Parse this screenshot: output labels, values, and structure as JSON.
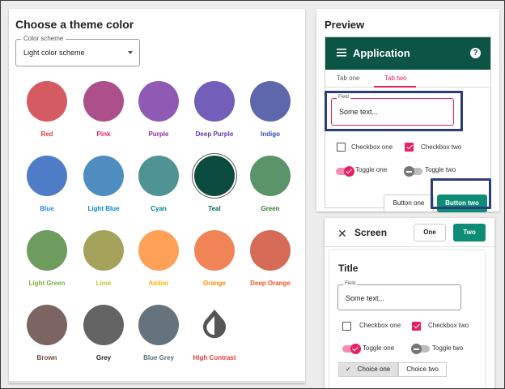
{
  "theme": {
    "title": "Choose a theme color",
    "scheme_label": "Color scheme",
    "scheme_value": "Light color scheme",
    "swatches": [
      {
        "label": "Red",
        "color": "#d45b62",
        "label_color": "#e53935"
      },
      {
        "label": "Pink",
        "color": "#ad4f8b",
        "label_color": "#e91e63"
      },
      {
        "label": "Purple",
        "color": "#8e5ab4",
        "label_color": "#8e24aa"
      },
      {
        "label": "Deep Purple",
        "color": "#735fb9",
        "label_color": "#5e35b1"
      },
      {
        "label": "Indigo",
        "color": "#5f67ac",
        "label_color": "#3949ab"
      },
      {
        "label": "Blue",
        "color": "#4e7cc6",
        "label_color": "#1e88e5"
      },
      {
        "label": "Light Blue",
        "color": "#4f8cc0",
        "label_color": "#0288d1"
      },
      {
        "label": "Cyan",
        "color": "#4f9395",
        "label_color": "#00838f"
      },
      {
        "label": "Teal",
        "color": "#0b4c3f",
        "label_color": "#00695c"
      },
      {
        "label": "Green",
        "color": "#5a9468",
        "label_color": "#2e7d32"
      },
      {
        "label": "Light Green",
        "color": "#6e9c5e",
        "label_color": "#7cb342"
      },
      {
        "label": "Lime",
        "color": "#a5a25c",
        "label_color": "#c0ca33"
      },
      {
        "label": "Amber",
        "color": "#ffa057",
        "label_color": "#ffb300"
      },
      {
        "label": "Orange",
        "color": "#f18457",
        "label_color": "#fb8c00"
      },
      {
        "label": "Deep Orange",
        "color": "#d66c57",
        "label_color": "#f4511e"
      },
      {
        "label": "Brown",
        "color": "#7b6462",
        "label_color": "#6d4c41"
      },
      {
        "label": "Grey",
        "color": "#646464",
        "label_color": "#212121"
      },
      {
        "label": "Blue Grey",
        "color": "#66727c",
        "label_color": "#546e7a"
      },
      {
        "label": "High Contrast",
        "color": "",
        "label_color": "#e53935",
        "icon": "contrast-drop-icon"
      }
    ]
  },
  "preview": {
    "title": "Preview",
    "app_title": "Application",
    "help_glyph": "?",
    "tab_one": "Tab one",
    "tab_two": "Tab two",
    "field_label": "Field",
    "field_value": "Some text...",
    "checkbox_one": "Checkbox one",
    "checkbox_two": "Checkbox two",
    "toggle_one": "Toggle one",
    "toggle_two": "Toggle two",
    "button_one": "Button one",
    "button_two": "Button two",
    "accent_color": "#0c5546",
    "highlight_color": "#e91e63"
  },
  "screen": {
    "close_glyph": "✕",
    "title": "Screen",
    "one": "One",
    "two": "Two",
    "body_title": "Title",
    "field_label": "Field",
    "field_value": "Some text...",
    "checkbox_one": "Checkbox one",
    "checkbox_two": "Checkbox two",
    "toggle_one": "Toggle one",
    "toggle_two": "Toggle two",
    "choice_one": "Choice one",
    "choice_two": "Choice two"
  }
}
